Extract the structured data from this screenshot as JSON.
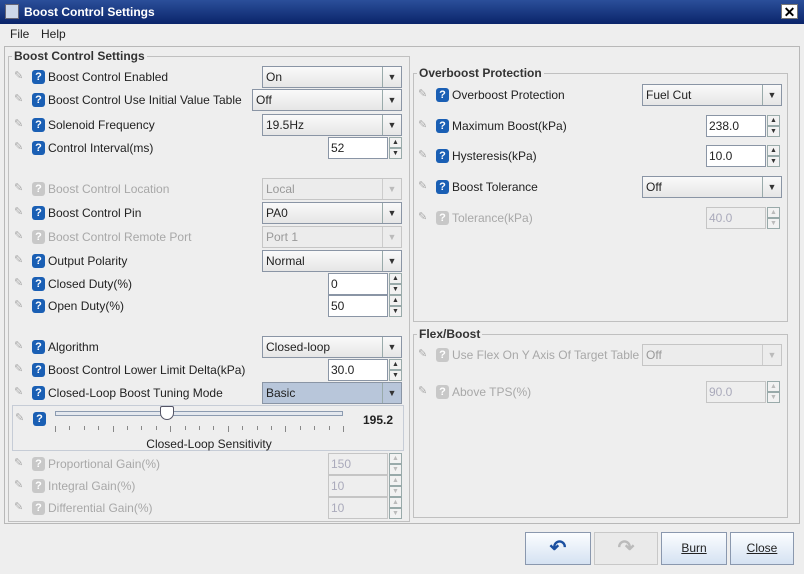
{
  "window": {
    "title": "Boost Control Settings",
    "close": "✕"
  },
  "menu": {
    "file": "File",
    "help": "Help"
  },
  "left": {
    "title": "Boost Control Settings",
    "rows": [
      {
        "label": "Boost Control Enabled",
        "type": "combo",
        "value": "On",
        "enabled": true
      },
      {
        "label": "Boost Control Use Initial Value Table",
        "type": "combo",
        "value": "Off",
        "enabled": true
      },
      {
        "label": "Solenoid Frequency",
        "type": "combo",
        "value": "19.5Hz",
        "enabled": true
      },
      {
        "label": "Control Interval(ms)",
        "type": "spin",
        "value": "52",
        "enabled": true
      },
      {
        "label": "Boost Control Location",
        "type": "combo",
        "value": "Local",
        "enabled": false
      },
      {
        "label": "Boost Control Pin",
        "type": "combo",
        "value": "PA0",
        "enabled": true
      },
      {
        "label": "Boost Control Remote Port",
        "type": "combo",
        "value": "Port 1",
        "enabled": false
      },
      {
        "label": "Output Polarity",
        "type": "combo",
        "value": "Normal",
        "enabled": true
      },
      {
        "label": "Closed Duty(%)",
        "type": "spin",
        "value": "0",
        "enabled": true
      },
      {
        "label": "Open Duty(%)",
        "type": "spin",
        "value": "50",
        "enabled": true
      },
      {
        "label": "Algorithm",
        "type": "combo",
        "value": "Closed-loop",
        "enabled": true
      },
      {
        "label": "Boost Control Lower Limit Delta(kPa)",
        "type": "spin",
        "value": "30.0",
        "enabled": true
      },
      {
        "label": "Closed-Loop Boost Tuning Mode",
        "type": "combo",
        "value": "Basic",
        "enabled": true
      },
      {
        "label": "Proportional Gain(%)",
        "type": "spin",
        "value": "150",
        "enabled": false
      },
      {
        "label": "Integral Gain(%)",
        "type": "spin",
        "value": "10",
        "enabled": false
      },
      {
        "label": "Differential Gain(%)",
        "type": "spin",
        "value": "10",
        "enabled": false
      }
    ],
    "slider": {
      "label": "Closed-Loop Sensitivity",
      "value": "195.2",
      "fraction": 0.39
    }
  },
  "overboost": {
    "title": "Overboost Protection",
    "rows": [
      {
        "label": "Overboost Protection",
        "type": "combo",
        "value": "Fuel Cut",
        "enabled": true
      },
      {
        "label": "Maximum Boost(kPa)",
        "type": "spin",
        "value": "238.0",
        "enabled": true
      },
      {
        "label": "Hysteresis(kPa)",
        "type": "spin",
        "value": "10.0",
        "enabled": true
      },
      {
        "label": "Boost Tolerance",
        "type": "combo",
        "value": "Off",
        "enabled": true
      },
      {
        "label": "Tolerance(kPa)",
        "type": "spin",
        "value": "40.0",
        "enabled": false
      }
    ]
  },
  "flex": {
    "title": "Flex/Boost",
    "rows": [
      {
        "label": "Use Flex On Y Axis Of Target Table",
        "type": "combo",
        "value": "Off",
        "enabled": false
      },
      {
        "label": "Above TPS(%)",
        "type": "spin",
        "value": "90.0",
        "enabled": false
      }
    ]
  },
  "buttons": {
    "undo": "↶",
    "redo": "↷",
    "burn": "Burn",
    "close": "Close"
  }
}
